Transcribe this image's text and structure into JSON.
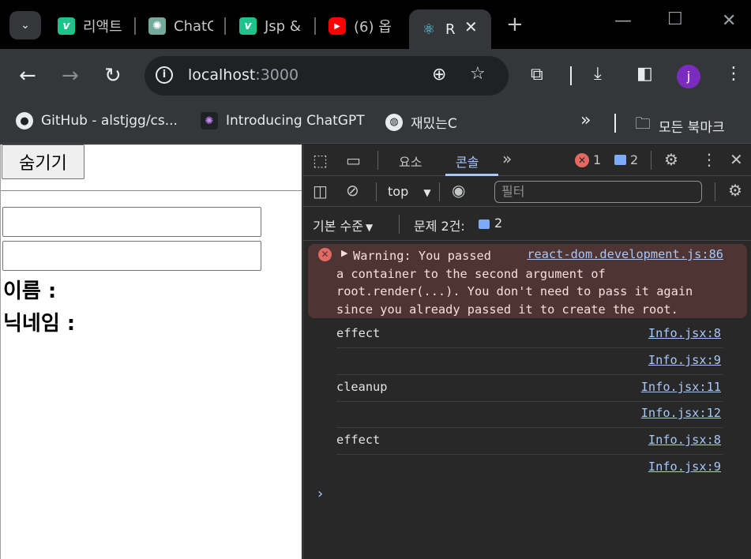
{
  "browser": {
    "tabs": [
      {
        "label": "리액트",
        "icon": "v-icon",
        "color": "#1ec28b"
      },
      {
        "label": "ChatG",
        "icon": "chatgpt-icon",
        "color": "#74aa9c"
      },
      {
        "label": "Jsp &",
        "icon": "v-icon",
        "color": "#1ec28b"
      },
      {
        "label": "(6) 옵",
        "icon": "youtube-icon",
        "color": "#ff0000"
      },
      {
        "label": "R",
        "icon": "react-icon",
        "color": "#61dafb"
      }
    ],
    "new_tab": "+",
    "url_host": "localhost",
    "url_port": ":3000",
    "profile_initial": "j",
    "bookmarks": [
      {
        "label": "GitHub - alstjgg/cs...",
        "icon": "github-icon"
      },
      {
        "label": "Introducing ChatGPT",
        "icon": "chatgpt-icon"
      },
      {
        "label": "재밌는C",
        "icon": "globe-icon"
      }
    ],
    "more_bookmarks": "»",
    "all_bookmarks": "모든 북마크"
  },
  "page": {
    "hide_button": "숨기기",
    "name_label": "이름 :",
    "nickname_label": "닉네임 :",
    "input1_value": "",
    "input2_value": ""
  },
  "devtools": {
    "tabs": {
      "elements": "요소",
      "console": "콘솔",
      "more": "»"
    },
    "errors": "1",
    "messages": "2",
    "context": "top",
    "filter_placeholder": "필터",
    "levels": "기본 수준",
    "issues_label": "문제 2건:",
    "issues_count": "2",
    "warning": {
      "text": "Warning: You passed\na container to the second argument of\nroot.render(...). You don't need to pass it again\nsince you already passed it to create the root.",
      "source": "react-dom.development.js:86"
    },
    "logs": [
      {
        "text": "effect",
        "source": "Info.jsx:8"
      },
      {
        "text": "",
        "source": "Info.jsx:9"
      },
      {
        "text": "cleanup",
        "source": "Info.jsx:11"
      },
      {
        "text": "",
        "source": "Info.jsx:12"
      },
      {
        "text": "effect",
        "source": "Info.jsx:8"
      },
      {
        "text": "",
        "source": "Info.jsx:9"
      }
    ],
    "prompt": "›"
  }
}
